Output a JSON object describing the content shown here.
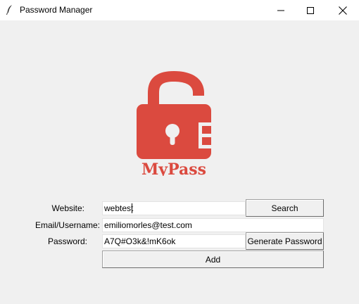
{
  "window": {
    "title": "Password Manager",
    "icon": "feather-icon"
  },
  "logo": {
    "text": "MyPass",
    "icon": "unlocked-padlock-icon",
    "color": "#db4a3f"
  },
  "form": {
    "website_label": "Website:",
    "website_value": "webtest",
    "email_label": "Email/Username:",
    "email_value": "emiliomorles@test.com",
    "password_label": "Password:",
    "password_value": "A7Q#O3k&!mK6ok",
    "search_button": "Search",
    "generate_button": "Generate Password",
    "add_button": "Add"
  }
}
